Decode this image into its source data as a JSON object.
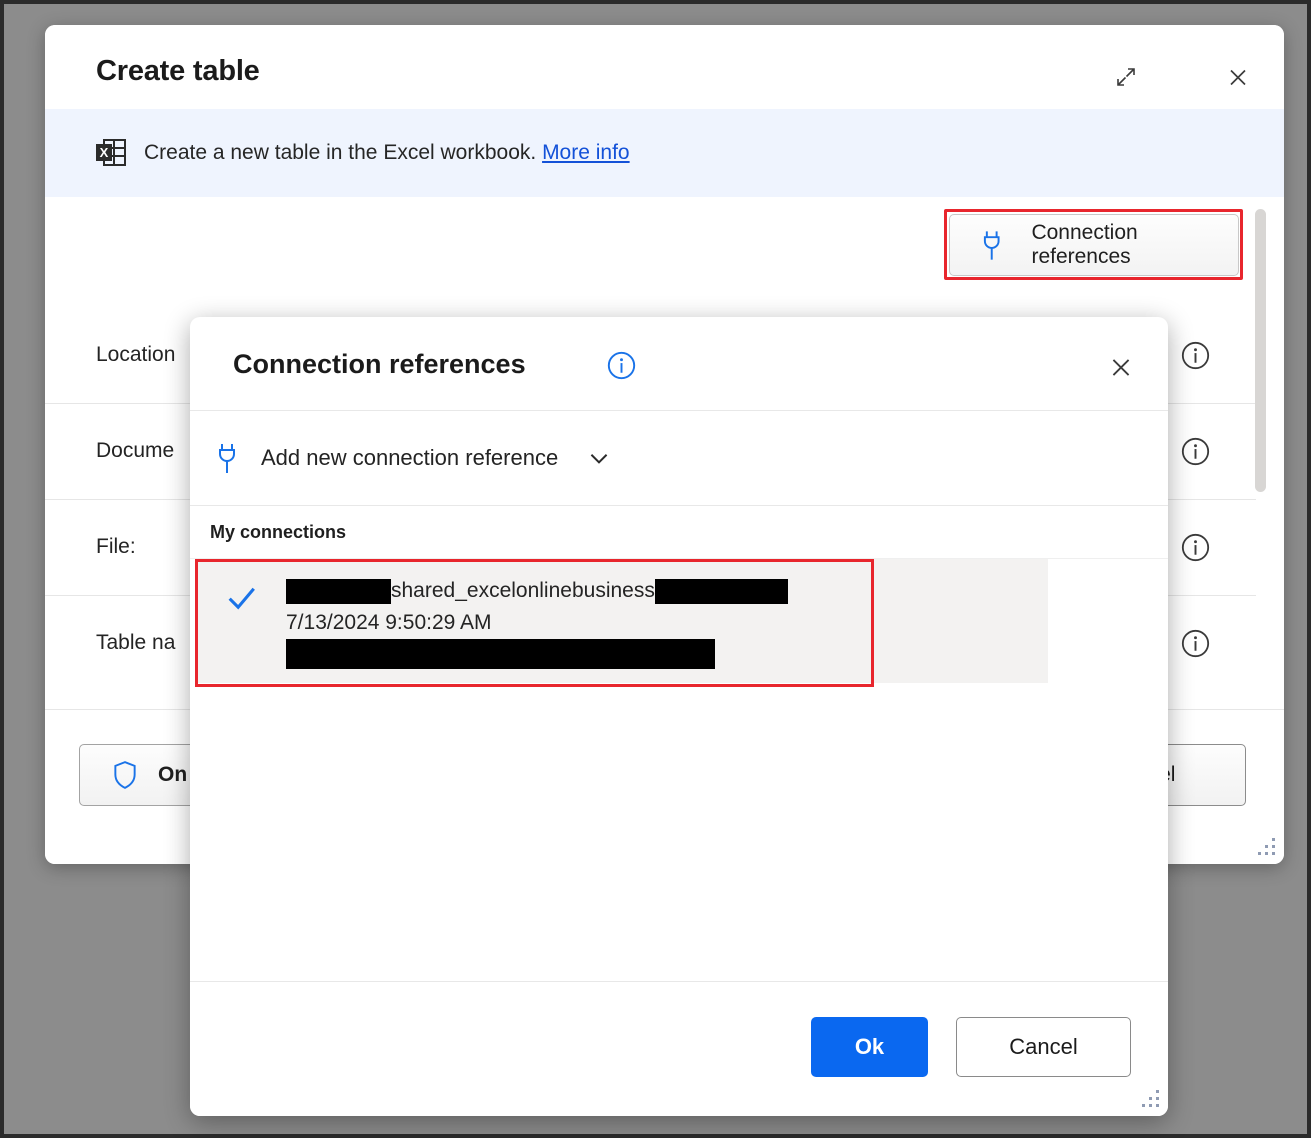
{
  "dialog": {
    "title": "Create table",
    "expand_icon": "expand-diagonal-icon",
    "close_icon": "close-icon",
    "banner": {
      "icon": "excel-table-icon",
      "text": "Create a new table in the Excel workbook.",
      "link_label": "More info"
    },
    "connection_references_button": {
      "label": "Connection references",
      "icon": "plug-icon"
    },
    "fields": [
      {
        "label": "Location",
        "info_icon": "info-circle-icon"
      },
      {
        "label": "Docume",
        "info_icon": "info-circle-icon"
      },
      {
        "label": "File:",
        "info_icon": "info-circle-icon"
      },
      {
        "label": "Table na",
        "info_icon": "info-circle-icon"
      }
    ],
    "footer": {
      "on_behalf_label": "On",
      "shield_icon": "shield-icon",
      "cancel_label": "cel"
    }
  },
  "panel": {
    "title": "Connection references",
    "info_icon": "info-circle-blue-icon",
    "close_icon": "close-icon",
    "add_connection": {
      "label": "Add new connection reference",
      "icon": "plug-icon",
      "chevron": "chevron-down-icon"
    },
    "section_header": "My connections",
    "connections": [
      {
        "check_icon": "checkmark-icon",
        "name_visible": "shared_excelonlinebusiness",
        "name_redacted_prefix_width": 105,
        "name_redacted_suffix_width": 133,
        "timestamp": "7/13/2024 9:50:29 AM",
        "detail_redacted_width": 429,
        "selected": true
      }
    ],
    "footer": {
      "ok_label": "Ok",
      "cancel_label": "Cancel"
    }
  },
  "colors": {
    "accent_blue": "#0a68f0",
    "link_blue": "#1351d8",
    "highlight_red": "#e8262d",
    "banner_bg": "#eff4fe",
    "selected_row_bg": "#f3f2f1",
    "backdrop": "#8c8c8c"
  }
}
